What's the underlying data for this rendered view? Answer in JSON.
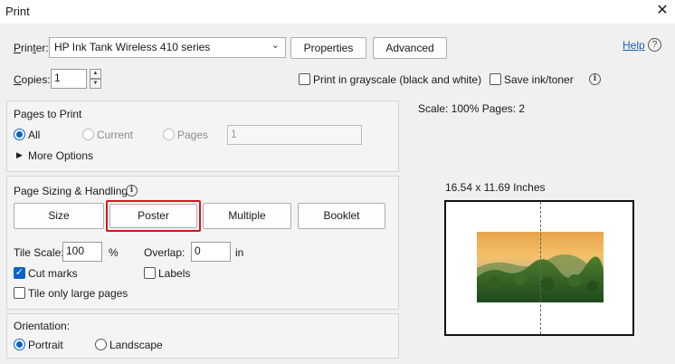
{
  "window": {
    "title": "Print"
  },
  "printer": {
    "label": "Printer:",
    "selected": "HP Ink Tank Wireless 410 series",
    "properties_label": "Properties",
    "advanced_label": "Advanced",
    "help_label": "Help"
  },
  "copies": {
    "label": "Copies:",
    "value": "1",
    "grayscale_label": "Print in grayscale (black and white)",
    "grayscale_checked": false,
    "save_ink_label": "Save ink/toner",
    "save_ink_checked": false
  },
  "pages_to_print": {
    "heading": "Pages to Print",
    "all_label": "All",
    "current_label": "Current",
    "pages_label": "Pages",
    "pages_value": "1",
    "selected": "All",
    "more_options_label": "More Options"
  },
  "sizing": {
    "heading": "Page Sizing & Handling",
    "buttons": [
      "Size",
      "Poster",
      "Multiple",
      "Booklet"
    ],
    "selected": "Poster",
    "tile_scale_label": "Tile Scale:",
    "tile_scale_value": "100",
    "tile_scale_unit": "%",
    "overlap_label": "Overlap:",
    "overlap_value": "0",
    "overlap_unit": "in",
    "cut_marks_label": "Cut marks",
    "cut_marks_checked": true,
    "labels_label": "Labels",
    "labels_checked": false,
    "tile_large_label": "Tile only large pages",
    "tile_large_checked": false
  },
  "orientation": {
    "heading": "Orientation:",
    "portrait_label": "Portrait",
    "landscape_label": "Landscape",
    "selected": "Portrait"
  },
  "preview": {
    "scale_text": "Scale: 100% Pages: 2",
    "dimensions_text": "16.54 x 11.69 Inches"
  },
  "icons": {
    "close": "close-icon",
    "dropdown": "chevron-down-icon",
    "info": "info-icon",
    "help": "help-icon",
    "expand": "triangle-right-icon"
  },
  "colors": {
    "accent": "#0a64c8",
    "highlight": "#d0181e",
    "link": "#1a5fb4"
  }
}
